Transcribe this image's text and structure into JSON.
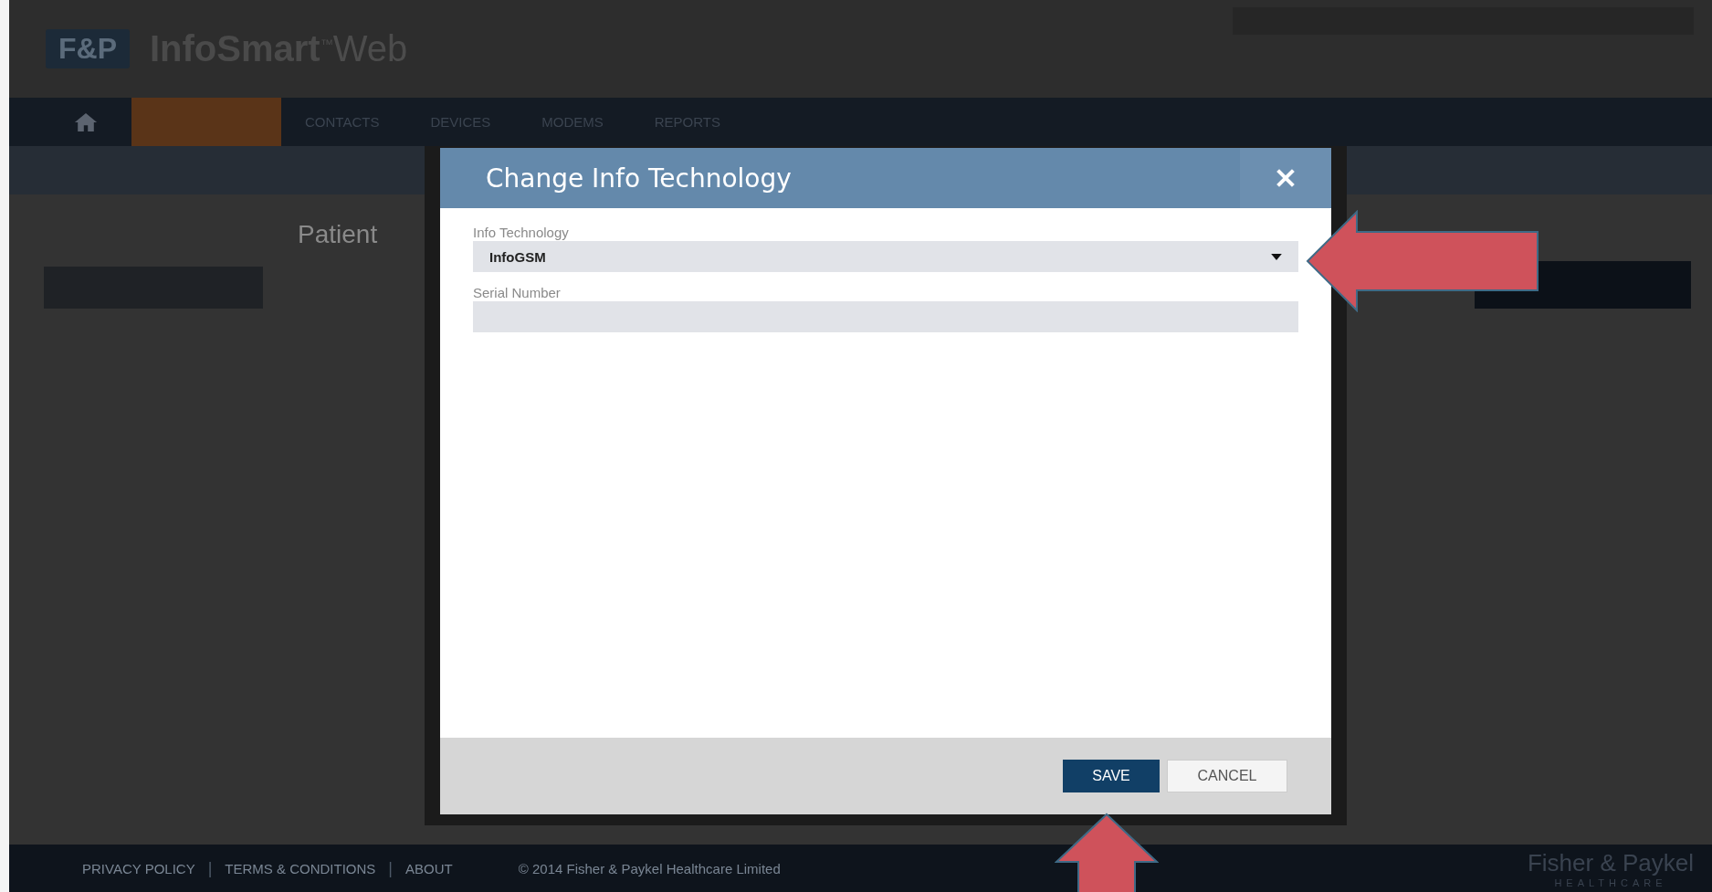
{
  "header": {
    "logo": "F&P",
    "app_name": "InfoSmart",
    "trademark": "™",
    "app_suffix": "Web"
  },
  "nav": {
    "tabs": [
      {
        "label": "CONTACTS"
      },
      {
        "label": "DEVICES"
      },
      {
        "label": "MODEMS"
      },
      {
        "label": "REPORTS"
      }
    ]
  },
  "page": {
    "title": "Patient"
  },
  "dialog": {
    "title": "Change Info Technology",
    "fields": [
      {
        "kind": "select",
        "label": "Info Technology",
        "value": "InfoGSM"
      },
      {
        "kind": "text",
        "label": "Serial Number"
      }
    ],
    "buttons": [
      {
        "label": "SAVE",
        "kind": "primary"
      },
      {
        "label": "CANCEL",
        "kind": "secondary"
      }
    ]
  },
  "footer": {
    "links": [
      {
        "kind": "link",
        "text": "PRIVACY POLICY"
      },
      {
        "kind": "separator",
        "text": "|"
      },
      {
        "kind": "link",
        "text": "TERMS & CONDITIONS"
      },
      {
        "kind": "separator",
        "text": "|"
      },
      {
        "kind": "link",
        "text": "ABOUT"
      }
    ],
    "copyright": "© 2014 Fisher & Paykel Healthcare Limited",
    "brand": "Fisher & Paykel",
    "brand_sub": "HEALTHCARE"
  },
  "annotations": [
    {
      "kind": "left"
    },
    {
      "kind": "up"
    }
  ]
}
